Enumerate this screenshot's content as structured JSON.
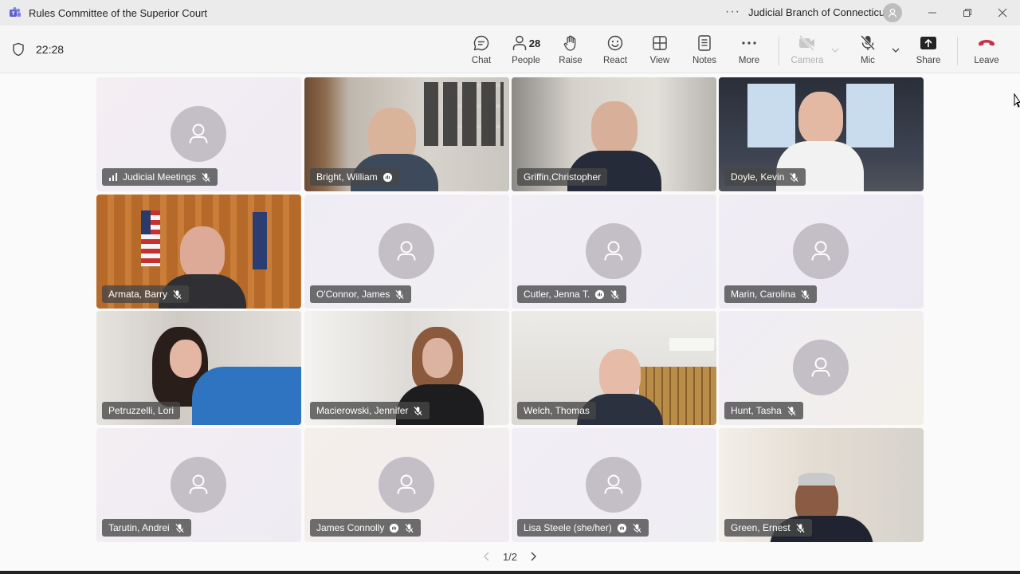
{
  "window": {
    "title": "Rules Committee of the Superior Court",
    "org": "Judicial Branch of Connecticut",
    "more_glyph": "···"
  },
  "toolbar": {
    "timer": "22:28",
    "chat": "Chat",
    "people": "People",
    "people_count": "28",
    "raise": "Raise",
    "react": "React",
    "view": "View",
    "notes": "Notes",
    "more": "More",
    "camera": "Camera",
    "mic": "Mic",
    "share": "Share",
    "leave": "Leave"
  },
  "colors": {
    "leave_red": "#c4314b",
    "speaking_outline": "#7f85f5",
    "teams_purple": "#5b5fc7"
  },
  "tiles": [
    {
      "name": "Judicial Meetings",
      "video": false,
      "muted": true,
      "audio_bars": true
    },
    {
      "name": "Bright, William",
      "video": true,
      "speaking": true,
      "hand_icon": true
    },
    {
      "name": "Griffin,Christopher",
      "video": true,
      "speaking": true
    },
    {
      "name": "Doyle, Kevin",
      "video": true,
      "muted": true
    },
    {
      "name": "Armata, Barry",
      "video": true,
      "muted": true
    },
    {
      "name": "O'Connor, James",
      "video": false,
      "muted": true
    },
    {
      "name": "Cutler, Jenna T.",
      "video": false,
      "muted": true,
      "hand_icon": true
    },
    {
      "name": "Marin, Carolina",
      "video": false,
      "muted": true
    },
    {
      "name": "Petruzzelli, Lori",
      "video": true
    },
    {
      "name": "Macierowski, Jennifer",
      "video": true,
      "muted": true
    },
    {
      "name": "Welch, Thomas",
      "video": true
    },
    {
      "name": "Hunt, Tasha",
      "video": false,
      "muted": true
    },
    {
      "name": "Tarutin, Andrei",
      "video": false,
      "muted": true
    },
    {
      "name": "James Connolly",
      "video": false,
      "muted": true,
      "hand_icon": true
    },
    {
      "name": "Lisa Steele (she/her)",
      "video": false,
      "muted": true,
      "hand_icon": true
    },
    {
      "name": "Green, Ernest",
      "video": true,
      "muted": true
    }
  ],
  "pager": {
    "label": "1/2"
  }
}
